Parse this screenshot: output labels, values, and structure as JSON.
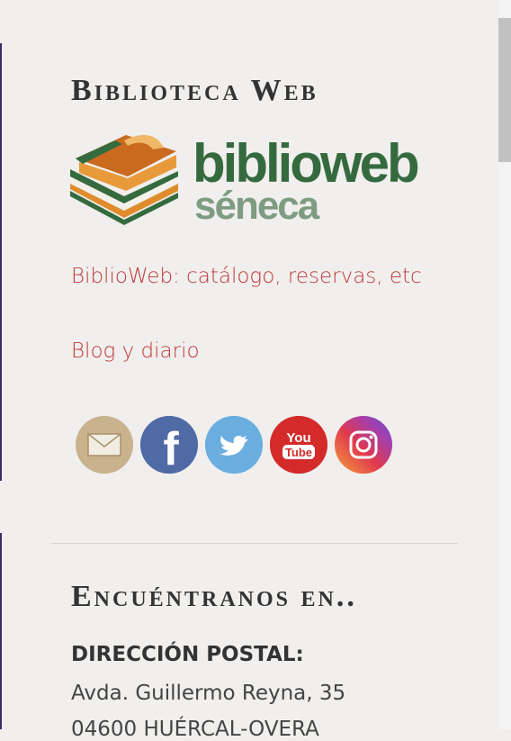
{
  "sidebar": {
    "library_title": "Biblioteca Web",
    "logo": {
      "word1": "biblioweb",
      "word2": "séneca",
      "colors": {
        "dark_green": "#356a3f",
        "light_green": "#7e9c82",
        "orange": "#e08c2c"
      }
    },
    "links": [
      {
        "label": "BiblioWeb: catálogo, reservas, etc"
      },
      {
        "label": "Blog y diario"
      }
    ],
    "social": [
      {
        "icon": "email-icon",
        "color": "#c9b38f"
      },
      {
        "icon": "facebook-icon",
        "color": "#4f6aa5",
        "glyph": "f"
      },
      {
        "icon": "twitter-icon",
        "color": "#6aaee0"
      },
      {
        "icon": "youtube-icon",
        "color": "#d42a2a",
        "text_top": "You",
        "text_bottom": "Tube"
      },
      {
        "icon": "instagram-icon",
        "color": "#c1356a"
      }
    ],
    "contact_title": "Encuéntranos en..",
    "postal_label": "DIRECCIÓN POSTAL:",
    "address_lines": [
      "Avda. Guillermo Reyna, 35",
      "04600 HUÉRCAL-OVERA"
    ]
  }
}
